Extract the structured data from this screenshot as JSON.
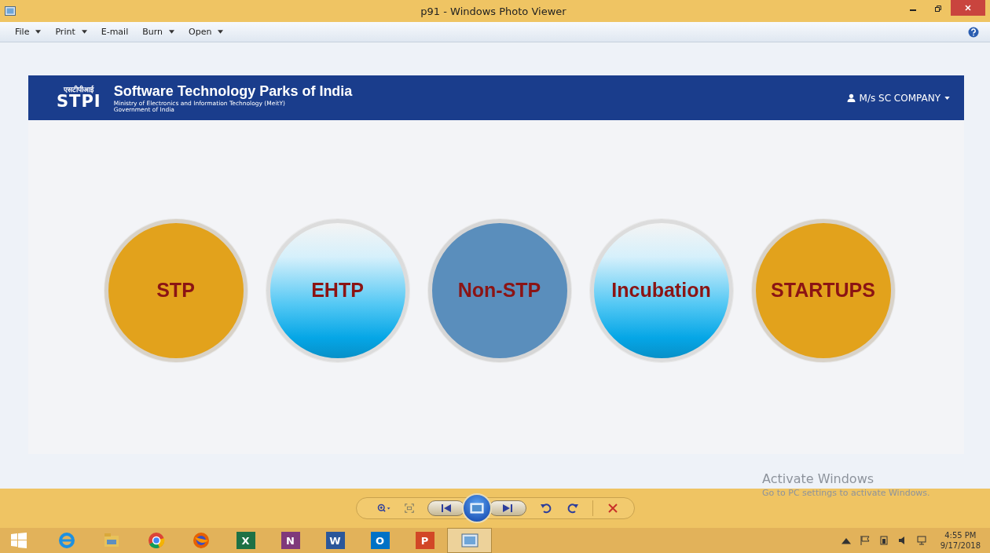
{
  "window": {
    "title": "p91 - Windows Photo Viewer"
  },
  "menu": [
    {
      "label": "File",
      "dropdown": true
    },
    {
      "label": "Print",
      "dropdown": true
    },
    {
      "label": "E-mail",
      "dropdown": false
    },
    {
      "label": "Burn",
      "dropdown": true
    },
    {
      "label": "Open",
      "dropdown": true
    }
  ],
  "header": {
    "logo_hindi": "एसटीपीआई",
    "logo_text": "STPI",
    "title": "Software Technology Parks of India",
    "subtitle": "Ministry of Electronics and Information Technology (MeitY)",
    "subtitle2": "Government of India",
    "user": "M/s SC COMPANY"
  },
  "tiles": [
    {
      "label": "STP",
      "kind": "gold"
    },
    {
      "label": "EHTP",
      "kind": "sky"
    },
    {
      "label": "Non-STP",
      "kind": "steel"
    },
    {
      "label": "Incubation",
      "kind": "sky"
    },
    {
      "label": "STARTUPS",
      "kind": "gold"
    }
  ],
  "watermark": {
    "title": "Activate Windows",
    "text": "Go to PC settings to activate Windows."
  },
  "taskbar": {
    "apps": [
      {
        "kind": "ie"
      },
      {
        "kind": "explorer"
      },
      {
        "kind": "chrome"
      },
      {
        "kind": "firefox"
      },
      {
        "kind": "office",
        "letter": "X",
        "color": "#1e7145"
      },
      {
        "kind": "office",
        "letter": "N",
        "color": "#80397b"
      },
      {
        "kind": "office",
        "letter": "W",
        "color": "#2b579a"
      },
      {
        "kind": "office",
        "letter": "O",
        "color": "#0072c6"
      },
      {
        "kind": "office",
        "letter": "P",
        "color": "#d24726"
      },
      {
        "kind": "photos"
      }
    ],
    "time": "4:55 PM",
    "date": "9/17/2018"
  }
}
